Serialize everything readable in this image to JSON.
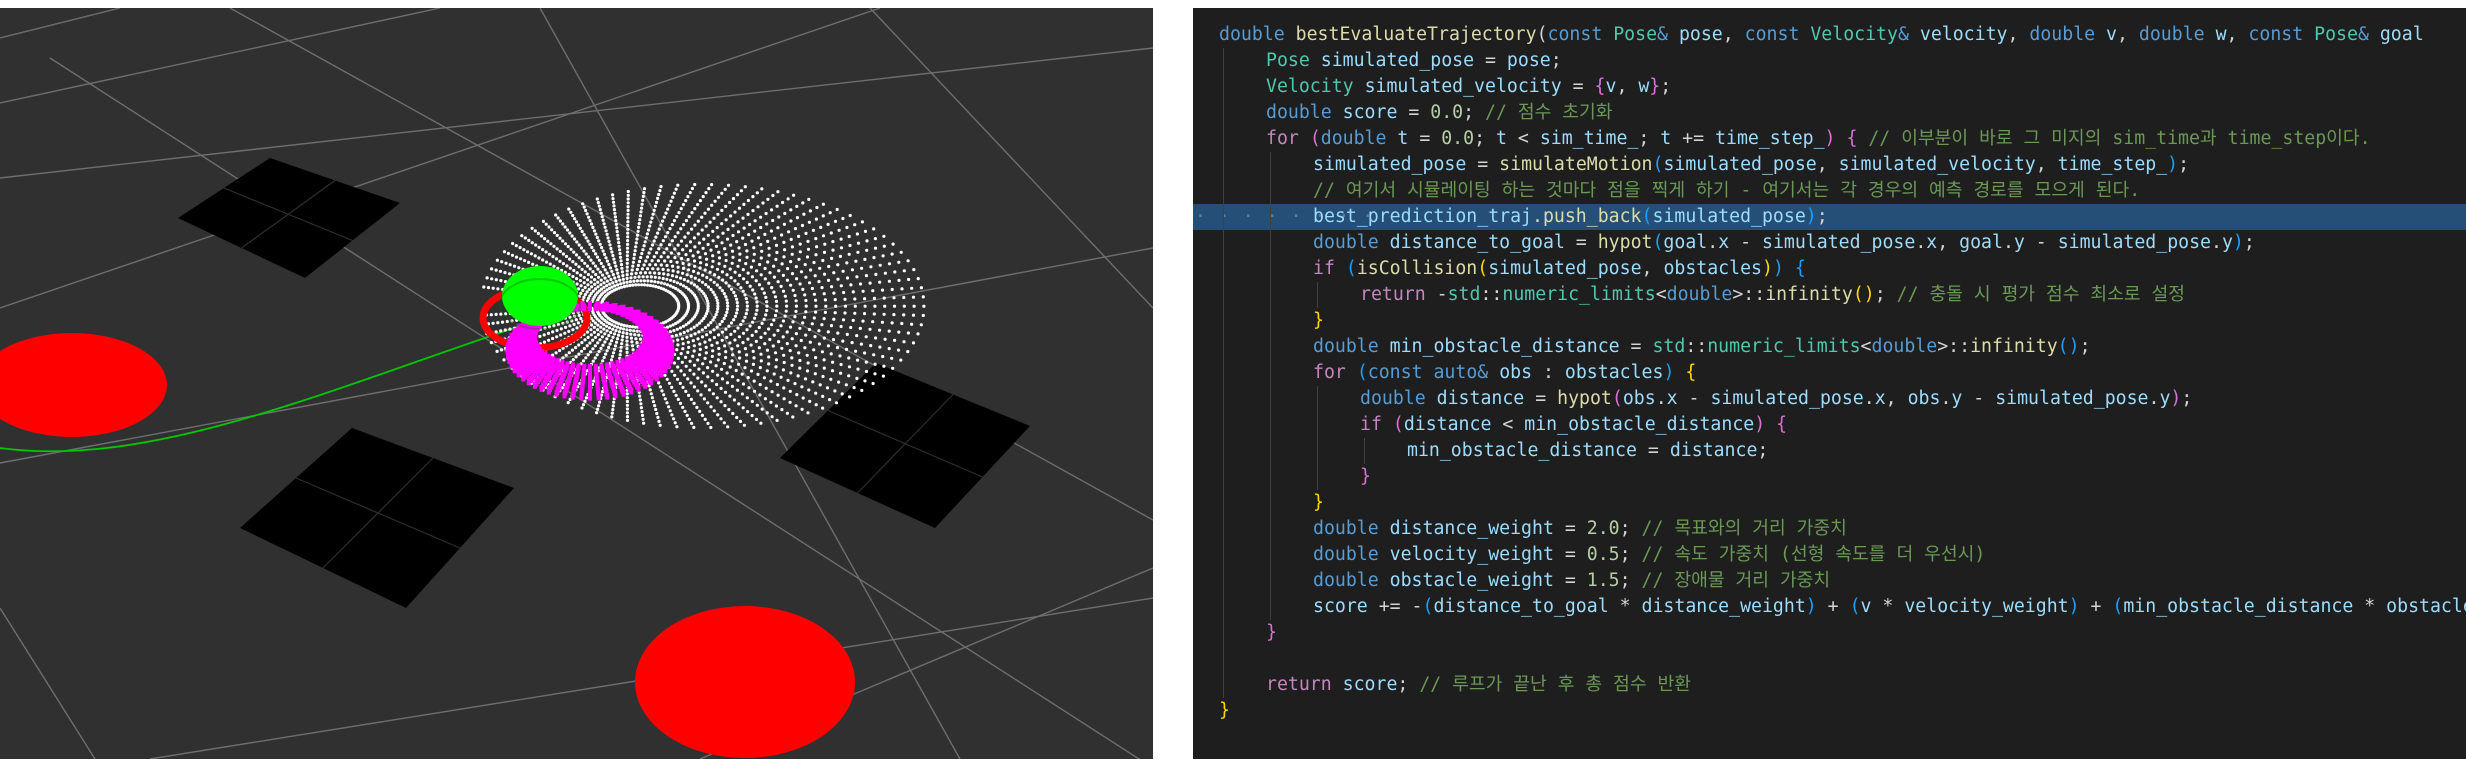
{
  "viz": {
    "colors": {
      "background": "#303030",
      "grid": "#6e6e6e",
      "obstacle_cell": "#000000",
      "goal_disc": "#ff0000",
      "path": "#00c800",
      "trajectory_white": "#ffffff",
      "trajectory_magenta": "#ff00ff",
      "robot": "#00ff00"
    }
  },
  "code": {
    "highlighted_line": 9,
    "lines": [
      {
        "indent": 0,
        "tokens": [
          [
            "kw",
            "double "
          ],
          [
            "fn",
            "bestEvaluateTrajectory"
          ],
          [
            "op",
            "("
          ],
          [
            "kw",
            "const "
          ],
          [
            "ty",
            "Pose"
          ],
          [
            "kw",
            "& "
          ],
          [
            "var",
            "pose"
          ],
          [
            "op",
            ", "
          ],
          [
            "kw",
            "const "
          ],
          [
            "ty",
            "Velocity"
          ],
          [
            "kw",
            "& "
          ],
          [
            "var",
            "velocity"
          ],
          [
            "op",
            ", "
          ],
          [
            "kw",
            "double "
          ],
          [
            "var",
            "v"
          ],
          [
            "op",
            ", "
          ],
          [
            "kw",
            "double "
          ],
          [
            "var",
            "w"
          ],
          [
            "op",
            ", "
          ],
          [
            "kw",
            "const "
          ],
          [
            "ty",
            "Pose"
          ],
          [
            "kw",
            "& "
          ],
          [
            "var",
            "goal"
          ]
        ]
      },
      {
        "indent": 1,
        "tokens": [
          [
            "ty",
            "Pose "
          ],
          [
            "var",
            "simulated_pose"
          ],
          [
            "op",
            " = "
          ],
          [
            "var",
            "pose"
          ],
          [
            "op",
            ";"
          ]
        ]
      },
      {
        "indent": 1,
        "tokens": [
          [
            "ty",
            "Velocity "
          ],
          [
            "var",
            "simulated_velocity"
          ],
          [
            "op",
            " = "
          ],
          [
            "br2",
            "{"
          ],
          [
            "var",
            "v"
          ],
          [
            "op",
            ", "
          ],
          [
            "var",
            "w"
          ],
          [
            "br2",
            "}"
          ],
          [
            "op",
            ";"
          ]
        ]
      },
      {
        "indent": 1,
        "tokens": [
          [
            "kw",
            "double "
          ],
          [
            "var",
            "score"
          ],
          [
            "op",
            " = "
          ],
          [
            "num",
            "0.0"
          ],
          [
            "op",
            "; "
          ],
          [
            "cm",
            "// 점수 초기화"
          ]
        ]
      },
      {
        "indent": 1,
        "tokens": [
          [
            "ctl",
            "for "
          ],
          [
            "br2",
            "("
          ],
          [
            "kw",
            "double "
          ],
          [
            "var",
            "t"
          ],
          [
            "op",
            " = "
          ],
          [
            "num",
            "0.0"
          ],
          [
            "op",
            "; "
          ],
          [
            "var",
            "t"
          ],
          [
            "op",
            " < "
          ],
          [
            "var",
            "sim_time_"
          ],
          [
            "op",
            "; "
          ],
          [
            "var",
            "t"
          ],
          [
            "op",
            " += "
          ],
          [
            "var",
            "time_step_"
          ],
          [
            "br2",
            ")"
          ],
          [
            "op",
            " "
          ],
          [
            "br2",
            "{"
          ],
          [
            "op",
            " "
          ],
          [
            "cm",
            "// 이부분이 바로 그 미지의 sim_time과 time_step이다."
          ]
        ]
      },
      {
        "indent": 2,
        "tokens": [
          [
            "var",
            "simulated_pose"
          ],
          [
            "op",
            " = "
          ],
          [
            "fn",
            "simulateMotion"
          ],
          [
            "br3",
            "("
          ],
          [
            "var",
            "simulated_pose"
          ],
          [
            "op",
            ", "
          ],
          [
            "var",
            "simulated_velocity"
          ],
          [
            "op",
            ", "
          ],
          [
            "var",
            "time_step_"
          ],
          [
            "br3",
            ")"
          ],
          [
            "op",
            ";"
          ]
        ]
      },
      {
        "indent": 2,
        "tokens": [
          [
            "cm",
            "// 여기서 시뮬레이팅 하는 것마다 점을 찍게 하기 - 여기서는 각 경우의 예측 경로를 모으게 된다."
          ]
        ]
      },
      {
        "indent": 2,
        "dots": "· · · · · · · · ",
        "tokens": [
          [
            "var",
            "best_prediction_traj"
          ],
          [
            "op",
            "."
          ],
          [
            "fn",
            "push_back"
          ],
          [
            "br3",
            "("
          ],
          [
            "var",
            "simulated_pose"
          ],
          [
            "br3",
            ")"
          ],
          [
            "op",
            ";"
          ]
        ]
      },
      {
        "indent": 2,
        "tokens": [
          [
            "kw",
            "double "
          ],
          [
            "var",
            "distance_to_goal"
          ],
          [
            "op",
            " = "
          ],
          [
            "fn",
            "hypot"
          ],
          [
            "br3",
            "("
          ],
          [
            "var",
            "goal"
          ],
          [
            "op",
            "."
          ],
          [
            "var",
            "x"
          ],
          [
            "op",
            " - "
          ],
          [
            "var",
            "simulated_pose"
          ],
          [
            "op",
            "."
          ],
          [
            "var",
            "x"
          ],
          [
            "op",
            ", "
          ],
          [
            "var",
            "goal"
          ],
          [
            "op",
            "."
          ],
          [
            "var",
            "y"
          ],
          [
            "op",
            " - "
          ],
          [
            "var",
            "simulated_pose"
          ],
          [
            "op",
            "."
          ],
          [
            "var",
            "y"
          ],
          [
            "br3",
            ")"
          ],
          [
            "op",
            ";"
          ]
        ]
      },
      {
        "indent": 2,
        "tokens": [
          [
            "ctl",
            "if "
          ],
          [
            "br3",
            "("
          ],
          [
            "fn",
            "isCollision"
          ],
          [
            "br1",
            "("
          ],
          [
            "var",
            "simulated_pose"
          ],
          [
            "op",
            ", "
          ],
          [
            "var",
            "obstacles"
          ],
          [
            "br1",
            ")"
          ],
          [
            "br3",
            ")"
          ],
          [
            "op",
            " "
          ],
          [
            "br3",
            "{"
          ]
        ]
      },
      {
        "indent": 3,
        "tokens": [
          [
            "ctl",
            "return "
          ],
          [
            "op",
            "-"
          ],
          [
            "ty",
            "std"
          ],
          [
            "op",
            "::"
          ],
          [
            "ty",
            "numeric_limits"
          ],
          [
            "op",
            "<"
          ],
          [
            "kw",
            "double"
          ],
          [
            "op",
            ">::"
          ],
          [
            "fn",
            "infinity"
          ],
          [
            "br1",
            "()"
          ],
          [
            "op",
            "; "
          ],
          [
            "cm",
            "// 충돌 시 평가 점수 최소로 설정"
          ]
        ]
      },
      {
        "indent": 2,
        "tokens": [
          [
            "br1",
            "}"
          ]
        ]
      },
      {
        "indent": 2,
        "tokens": [
          [
            "kw",
            "double "
          ],
          [
            "var",
            "min_obstacle_distance"
          ],
          [
            "op",
            " = "
          ],
          [
            "ty",
            "std"
          ],
          [
            "op",
            "::"
          ],
          [
            "ty",
            "numeric_limits"
          ],
          [
            "op",
            "<"
          ],
          [
            "kw",
            "double"
          ],
          [
            "op",
            ">::"
          ],
          [
            "fn",
            "infinity"
          ],
          [
            "br3",
            "()"
          ],
          [
            "op",
            ";"
          ]
        ]
      },
      {
        "indent": 2,
        "tokens": [
          [
            "ctl",
            "for "
          ],
          [
            "br3",
            "("
          ],
          [
            "kw",
            "const "
          ],
          [
            "kw",
            "auto"
          ],
          [
            "kw",
            "& "
          ],
          [
            "var",
            "obs"
          ],
          [
            "op",
            " : "
          ],
          [
            "var",
            "obstacles"
          ],
          [
            "br3",
            ")"
          ],
          [
            "op",
            " "
          ],
          [
            "br1",
            "{"
          ]
        ]
      },
      {
        "indent": 3,
        "tokens": [
          [
            "kw",
            "double "
          ],
          [
            "var",
            "distance"
          ],
          [
            "op",
            " = "
          ],
          [
            "fn",
            "hypot"
          ],
          [
            "br2",
            "("
          ],
          [
            "var",
            "obs"
          ],
          [
            "op",
            "."
          ],
          [
            "var",
            "x"
          ],
          [
            "op",
            " - "
          ],
          [
            "var",
            "simulated_pose"
          ],
          [
            "op",
            "."
          ],
          [
            "var",
            "x"
          ],
          [
            "op",
            ", "
          ],
          [
            "var",
            "obs"
          ],
          [
            "op",
            "."
          ],
          [
            "var",
            "y"
          ],
          [
            "op",
            " - "
          ],
          [
            "var",
            "simulated_pose"
          ],
          [
            "op",
            "."
          ],
          [
            "var",
            "y"
          ],
          [
            "br2",
            ")"
          ],
          [
            "op",
            ";"
          ]
        ]
      },
      {
        "indent": 3,
        "tokens": [
          [
            "ctl",
            "if "
          ],
          [
            "br2",
            "("
          ],
          [
            "var",
            "distance"
          ],
          [
            "op",
            " < "
          ],
          [
            "var",
            "min_obstacle_distance"
          ],
          [
            "br2",
            ")"
          ],
          [
            "op",
            " "
          ],
          [
            "br2",
            "{"
          ]
        ]
      },
      {
        "indent": 4,
        "tokens": [
          [
            "var",
            "min_obstacle_distance"
          ],
          [
            "op",
            " = "
          ],
          [
            "var",
            "distance"
          ],
          [
            "op",
            ";"
          ]
        ]
      },
      {
        "indent": 3,
        "tokens": [
          [
            "br2",
            "}"
          ]
        ]
      },
      {
        "indent": 2,
        "tokens": [
          [
            "br1",
            "}"
          ]
        ]
      },
      {
        "indent": 2,
        "tokens": [
          [
            "kw",
            "double "
          ],
          [
            "var",
            "distance_weight"
          ],
          [
            "op",
            " = "
          ],
          [
            "num",
            "2.0"
          ],
          [
            "op",
            "; "
          ],
          [
            "cm",
            "// 목표와의 거리 가중치"
          ]
        ]
      },
      {
        "indent": 2,
        "tokens": [
          [
            "kw",
            "double "
          ],
          [
            "var",
            "velocity_weight"
          ],
          [
            "op",
            " = "
          ],
          [
            "num",
            "0.5"
          ],
          [
            "op",
            "; "
          ],
          [
            "cm",
            "// 속도 가중치 (선형 속도를 더 우선시)"
          ]
        ]
      },
      {
        "indent": 2,
        "tokens": [
          [
            "kw",
            "double "
          ],
          [
            "var",
            "obstacle_weight"
          ],
          [
            "op",
            " = "
          ],
          [
            "num",
            "1.5"
          ],
          [
            "op",
            "; "
          ],
          [
            "cm",
            "// 장애물 거리 가중치"
          ]
        ]
      },
      {
        "indent": 2,
        "tokens": [
          [
            "var",
            "score"
          ],
          [
            "op",
            " += -"
          ],
          [
            "br3",
            "("
          ],
          [
            "var",
            "distance_to_goal"
          ],
          [
            "op",
            " * "
          ],
          [
            "var",
            "distance_weight"
          ],
          [
            "br3",
            ")"
          ],
          [
            "op",
            " + "
          ],
          [
            "br3",
            "("
          ],
          [
            "var",
            "v"
          ],
          [
            "op",
            " * "
          ],
          [
            "var",
            "velocity_weight"
          ],
          [
            "br3",
            ")"
          ],
          [
            "op",
            " + "
          ],
          [
            "br3",
            "("
          ],
          [
            "var",
            "min_obstacle_distance"
          ],
          [
            "op",
            " * "
          ],
          [
            "var",
            "obstacle_weight"
          ],
          [
            "br3",
            ")"
          ],
          [
            "op",
            ";"
          ]
        ]
      },
      {
        "indent": 1,
        "tokens": [
          [
            "br2",
            "}"
          ]
        ]
      },
      {
        "indent": 0,
        "tokens": []
      },
      {
        "indent": 1,
        "tokens": [
          [
            "ctl",
            "return "
          ],
          [
            "var",
            "score"
          ],
          [
            "op",
            "; "
          ],
          [
            "cm",
            "// 루프가 끝난 후 총 점수 반환"
          ]
        ]
      },
      {
        "indent": 0,
        "tokens": [
          [
            "br1",
            "}"
          ]
        ]
      }
    ]
  }
}
